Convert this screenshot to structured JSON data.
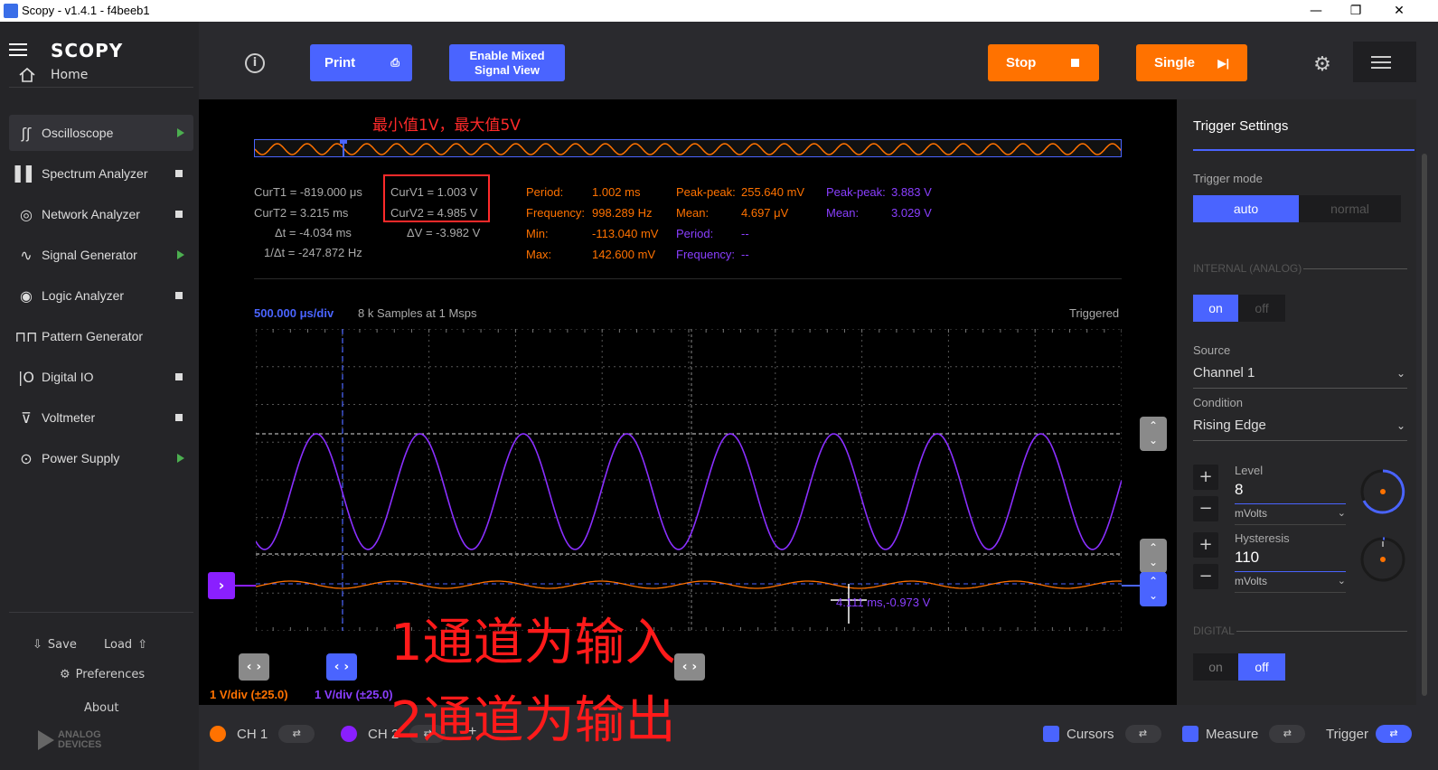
{
  "window": {
    "title": "Scopy - v1.4.1 - f4beeb1",
    "minimize": "—",
    "maximize": "❐",
    "close": "✕"
  },
  "sidebar": {
    "logo": "SCOPY",
    "home": "Home",
    "items": [
      {
        "label": "Oscilloscope",
        "status": "play",
        "active": true
      },
      {
        "label": "Spectrum Analyzer",
        "status": "stop"
      },
      {
        "label": "Network Analyzer",
        "status": "stop"
      },
      {
        "label": "Signal Generator",
        "status": "play"
      },
      {
        "label": "Logic Analyzer",
        "status": "stop"
      },
      {
        "label": "Pattern Generator",
        "status": "none"
      },
      {
        "label": "Digital IO",
        "status": "stop"
      },
      {
        "label": "Voltmeter",
        "status": "stop"
      },
      {
        "label": "Power Supply",
        "status": "play"
      }
    ],
    "save": "Save",
    "load": "Load",
    "preferences": "Preferences",
    "about": "About",
    "brand_line1": "ANALOG",
    "brand_line2": "DEVICES"
  },
  "toolbar": {
    "print": "Print",
    "mixed_line1": "Enable Mixed",
    "mixed_line2": "Signal View",
    "stop": "Stop",
    "single": "Single"
  },
  "plot": {
    "annotation_top": "最小值1V，最大值5V",
    "cursors": {
      "curt1": "CurT1 = -819.000 μs",
      "curt2": "CurT2 = 3.215 ms",
      "dt": "Δt = -4.034 ms",
      "inv_dt": "1/Δt = -247.872 Hz",
      "curv1": "CurV1 = 1.003 V",
      "curv2": "CurV2 = 4.985 V",
      "dv": "ΔV = -3.982 V"
    },
    "meas_ch1": {
      "period_lbl": "Period:",
      "period_val": "1.002 ms",
      "freq_lbl": "Frequency:",
      "freq_val": "998.289 Hz",
      "min_lbl": "Min:",
      "min_val": "-113.040 mV",
      "max_lbl": "Max:",
      "max_val": "142.600 mV",
      "pp_lbl": "Peak-peak:",
      "pp_val": "255.640 mV",
      "mean_lbl": "Mean:",
      "mean_val": "4.697 μV"
    },
    "meas_ch2_a": {
      "period_lbl": "Period:",
      "period_val": "--",
      "freq_lbl": "Frequency:",
      "freq_val": "--"
    },
    "meas_ch2_b": {
      "pp_lbl": "Peak-peak:",
      "pp_val": "3.883 V",
      "mean_lbl": "Mean:",
      "mean_val": "3.029 V"
    },
    "timebase": "500.000 μs/div",
    "samples": "8 k Samples at 1 Msps",
    "status": "Triggered",
    "cursor_readout": "4.111 ms,-0.973 V",
    "ch1_scale": "1 V/div (±25.0)",
    "ch2_scale": "1 V/div (±25.0)",
    "overlay_line1": "1通道为输入",
    "overlay_line2": "2通道为输出"
  },
  "trigger": {
    "title": "Trigger Settings",
    "mode_label": "Trigger mode",
    "mode_auto": "auto",
    "mode_normal": "normal",
    "internal_label": "INTERNAL (ANALOG)",
    "on": "on",
    "off": "off",
    "source_label": "Source",
    "source_value": "Channel 1",
    "condition_label": "Condition",
    "condition_value": "Rising Edge",
    "level_label": "Level",
    "level_value": "8",
    "level_unit": "mVolts",
    "hyst_label": "Hysteresis",
    "hyst_value": "110",
    "hyst_unit": "mVolts",
    "digital_label": "DIGITAL",
    "plus": "+",
    "minus": "−"
  },
  "bottom": {
    "ch1": "CH 1",
    "ch2": "CH 2",
    "add": "+",
    "cursors": "Cursors",
    "measure": "Measure",
    "trigger": "Trigger",
    "colors": {
      "ch1": "#ff7200",
      "ch2": "#8a1fff",
      "accent": "#4a64ff"
    }
  }
}
